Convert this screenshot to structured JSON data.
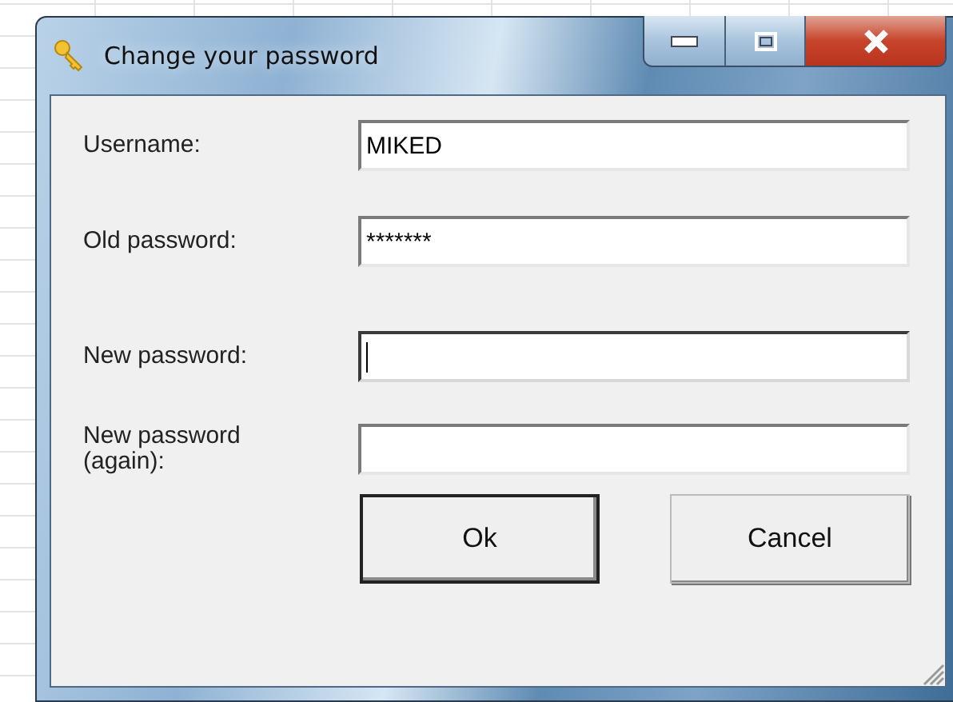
{
  "window": {
    "title": "Change your password"
  },
  "fields": [
    {
      "label": "Username:",
      "value": "MIKED",
      "focused": false
    },
    {
      "label": "Old password:",
      "value": "*******",
      "focused": false
    },
    {
      "label": "New password:",
      "focused": true
    },
    {
      "label": "New password (again):",
      "focused": false
    }
  ],
  "buttons": [
    {
      "label": "Ok",
      "default": true
    },
    {
      "label": "Cancel",
      "default": false
    }
  ]
}
